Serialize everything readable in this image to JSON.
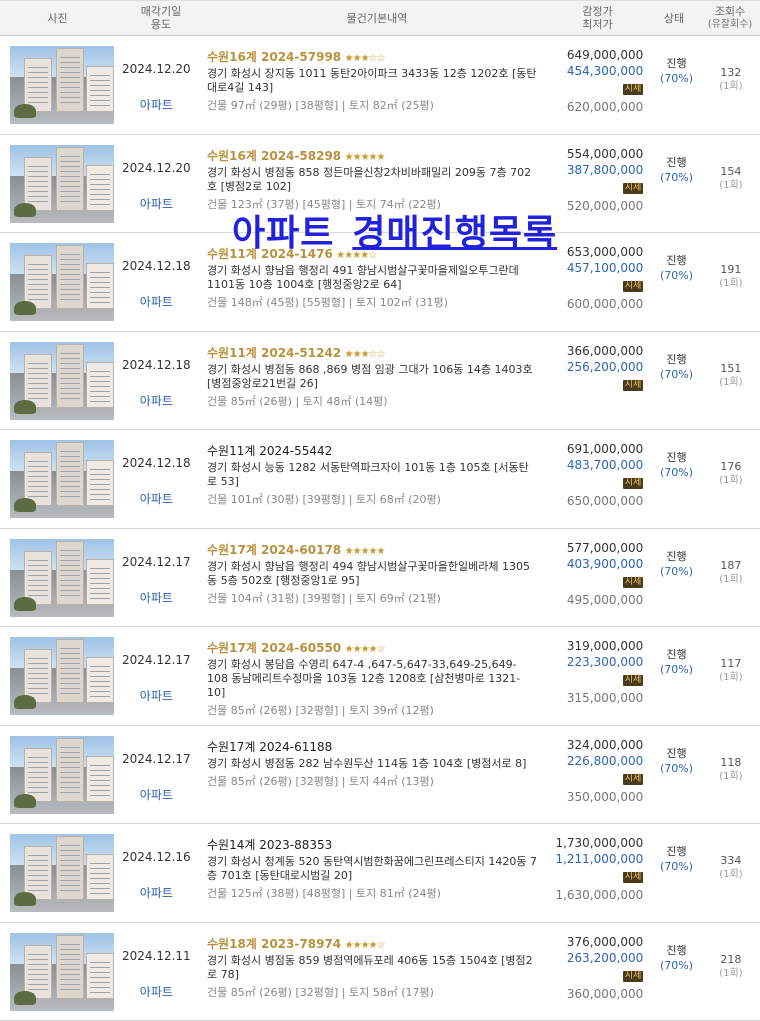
{
  "header": {
    "photo": "사진",
    "date_l1": "매각기일",
    "date_l2": "용도",
    "info": "물건기본내역",
    "price_l1": "감정가",
    "price_l2": "최저가",
    "status": "상태",
    "views_l1": "조회수",
    "views_l2": "(유찰회수)"
  },
  "overlay": {
    "part1": "아파트",
    "part2": "경매진행목록"
  },
  "rows": [
    {
      "date": "2024.12.20",
      "usage": "아파트",
      "case": "수원16계 2024-57998",
      "stars": "★★★☆☆",
      "addr": "경기 화성시 장지동 1011 동탄2아이파크 3433동 12층 1202호 [동탄대로4길 143]",
      "meta": "건물 97㎡ (29평) [38평형]  |  토지 82㎡ (25평)",
      "appraisal": "649,000,000",
      "minimum": "454,300,000",
      "sise": "시세",
      "low": "620,000,000",
      "status": "진행",
      "pct": "(70%)",
      "views": "132",
      "fails": "(1회)"
    },
    {
      "date": "2024.12.20",
      "usage": "아파트",
      "case": "수원16계 2024-58298",
      "stars": "★★★★★",
      "addr": "경기 화성시 병점동 858 정든마을신창2차비바패밀리 209동 7층 702호 [병점2로 102]",
      "meta": "건물 123㎡ (37평) [45평형]  |  토지 74㎡ (22평)",
      "appraisal": "554,000,000",
      "minimum": "387,800,000",
      "sise": "시세",
      "low": "520,000,000",
      "status": "진행",
      "pct": "(70%)",
      "views": "154",
      "fails": "(1회)"
    },
    {
      "date": "2024.12.18",
      "usage": "아파트",
      "case": "수원11계 2024-1476",
      "stars": "★★★★☆",
      "addr": "경기 화성시 향남읍 행정리 491 향남시범살구꽃마을제일오투그란데 1101동 10층 1004호 [행정중앙2로 64]",
      "meta": "건물 148㎡ (45평) [55평형]  |  토지 102㎡ (31평)",
      "appraisal": "653,000,000",
      "minimum": "457,100,000",
      "sise": "시세",
      "low": "600,000,000",
      "status": "진행",
      "pct": "(70%)",
      "views": "191",
      "fails": "(1회)"
    },
    {
      "date": "2024.12.18",
      "usage": "아파트",
      "case": "수원11계 2024-51242",
      "stars": "★★★☆☆",
      "addr": "경기 화성시 병점동 868 ,869 병점 임광 그대가 106동 14층 1403호 [병점중앙로21번길 26]",
      "meta": "건물 85㎡ (26평)  |  토지 48㎡ (14평)",
      "appraisal": "366,000,000",
      "minimum": "256,200,000",
      "sise": "시세",
      "low": "",
      "status": "진행",
      "pct": "(70%)",
      "views": "151",
      "fails": "(1회)"
    },
    {
      "date": "2024.12.18",
      "usage": "아파트",
      "case": "수원11계 2024-55442",
      "stars": "",
      "addr": "경기 화성시 능동 1282 서동탄역파크자이 101동 1층 105호 [서동탄로 53]",
      "meta": "건물 101㎡ (30평) [39평형]  |  토지 68㎡ (20평)",
      "appraisal": "691,000,000",
      "minimum": "483,700,000",
      "sise": "시세",
      "low": "650,000,000",
      "status": "진행",
      "pct": "(70%)",
      "views": "176",
      "fails": "(1회)"
    },
    {
      "date": "2024.12.17",
      "usage": "아파트",
      "case": "수원17계 2024-60178",
      "stars": "★★★★★",
      "addr": "경기 화성시 향남읍 행정리 494 향남시범살구꽃마을한일베라체 1305동 5층 502호 [행정중앙1로 95]",
      "meta": "건물 104㎡ (31평) [39평형]  |  토지 69㎡ (21평)",
      "appraisal": "577,000,000",
      "minimum": "403,900,000",
      "sise": "시세",
      "low": "495,000,000",
      "status": "진행",
      "pct": "(70%)",
      "views": "187",
      "fails": "(1회)"
    },
    {
      "date": "2024.12.17",
      "usage": "아파트",
      "case": "수원17계 2024-60550",
      "stars": "★★★★☆",
      "addr": "경기 화성시 봉담읍 수영리 647-4 ,647-5,647-33,649-25,649-108 동남메리트수정마을 103동 12층 1208호 [삼천병마로 1321-10]",
      "meta": "건물 85㎡ (26평) [32평형]  |  토지 39㎡ (12평)",
      "appraisal": "319,000,000",
      "minimum": "223,300,000",
      "sise": "시세",
      "low": "315,000,000",
      "status": "진행",
      "pct": "(70%)",
      "views": "117",
      "fails": "(1회)"
    },
    {
      "date": "2024.12.17",
      "usage": "아파트",
      "case": "수원17계 2024-61188",
      "stars": "",
      "addr": "경기 화성시 병점동 282 남수원두산 114동 1층 104호 [병점서로 8]",
      "meta": "건물 85㎡ (26평) [32평형]  |  토지 44㎡ (13평)",
      "appraisal": "324,000,000",
      "minimum": "226,800,000",
      "sise": "시세",
      "low": "350,000,000",
      "status": "진행",
      "pct": "(70%)",
      "views": "118",
      "fails": "(1회)"
    },
    {
      "date": "2024.12.16",
      "usage": "아파트",
      "case": "수원14계 2023-88353",
      "stars": "",
      "addr": "경기 화성시 청계동 520 동탄역시범한화꿈에그린프레스티지 1420동 7층 701호 [동탄대로시범길 20]",
      "meta": "건물 125㎡ (38평) [48평형]  |  토지 81㎡ (24평)",
      "appraisal": "1,730,000,000",
      "minimum": "1,211,000,000",
      "sise": "시세",
      "low": "1,630,000,000",
      "status": "진행",
      "pct": "(70%)",
      "views": "334",
      "fails": "(1회)"
    },
    {
      "date": "2024.12.11",
      "usage": "아파트",
      "case": "수원18계 2023-78974",
      "stars": "★★★★☆",
      "addr": "경기 화성시 병점동 859 병점역에듀포레 406동 15층 1504호 [병점2로 78]",
      "meta": "건물 85㎡ (26평) [32평형]  |  토지 58㎡ (17평)",
      "appraisal": "376,000,000",
      "minimum": "263,200,000",
      "sise": "시세",
      "low": "360,000,000",
      "status": "진행",
      "pct": "(70%)",
      "views": "218",
      "fails": "(1회)"
    }
  ]
}
